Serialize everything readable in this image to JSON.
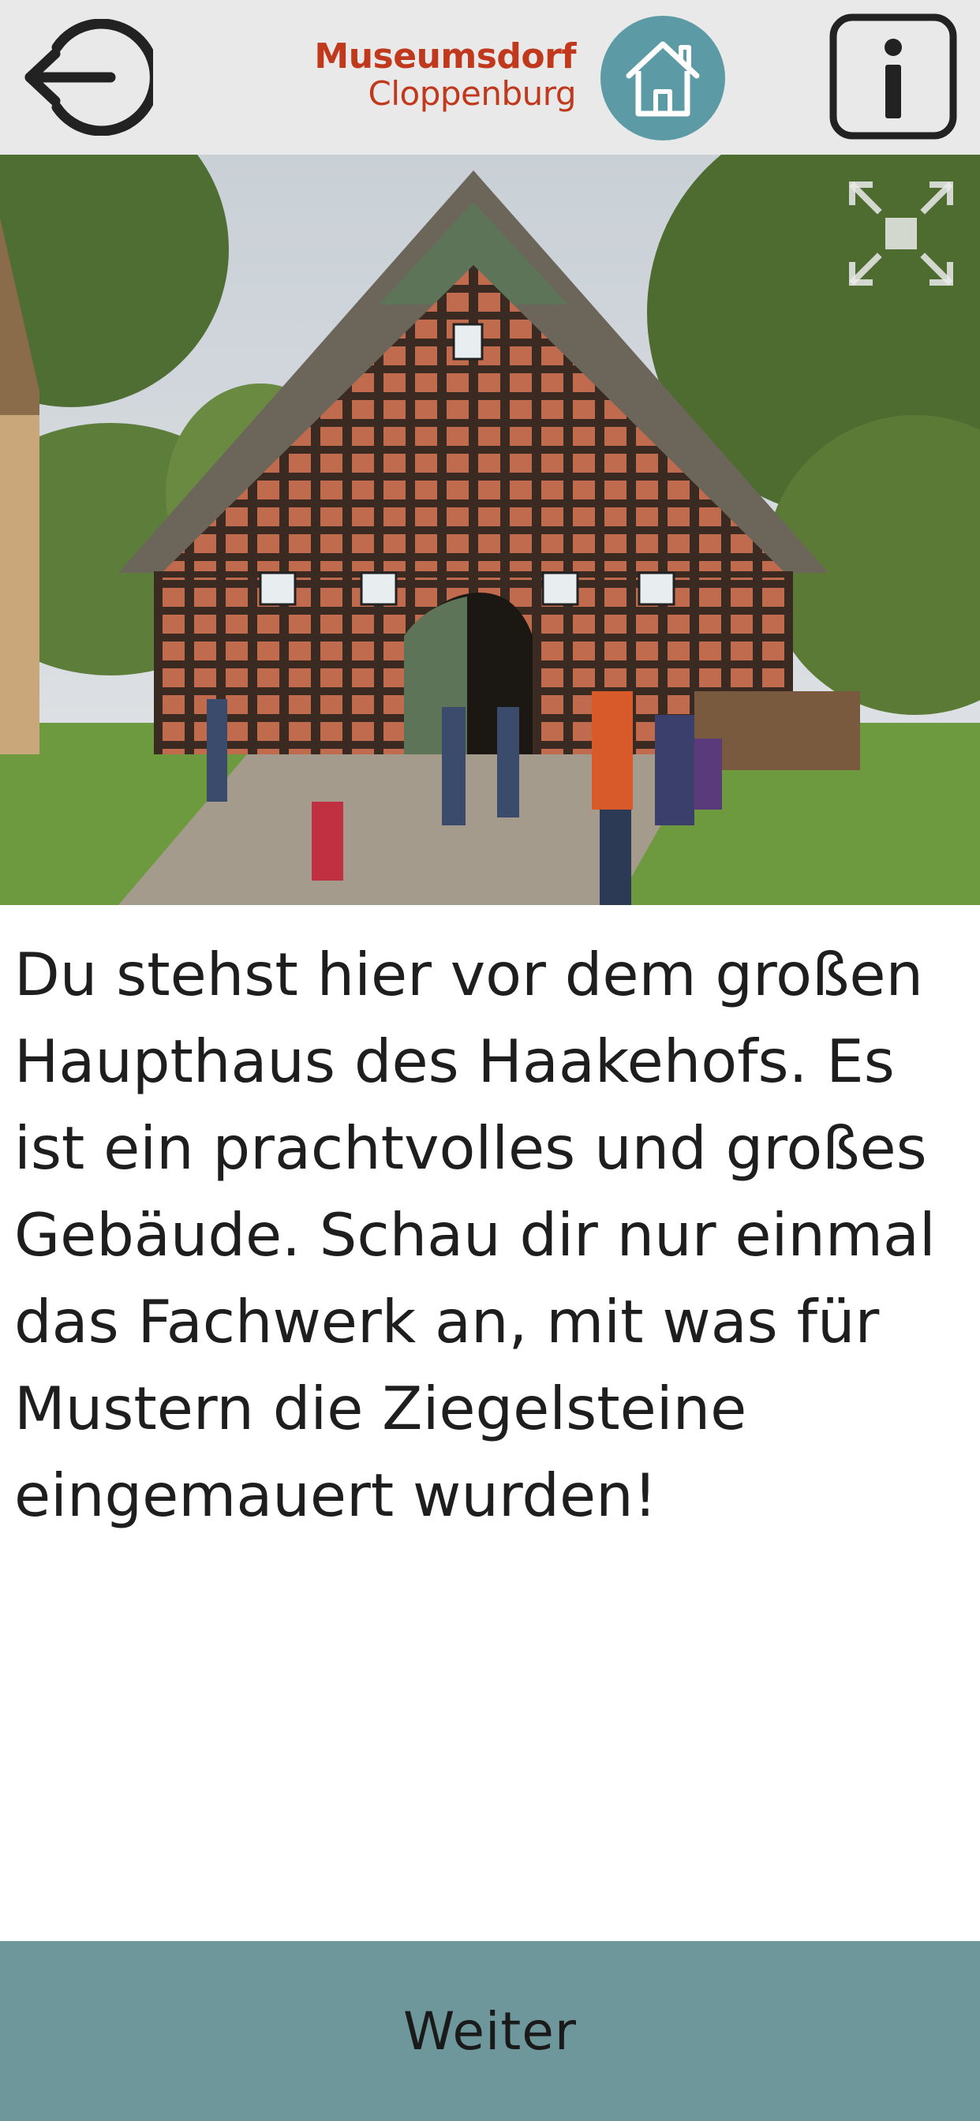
{
  "header": {
    "back_icon": "logout-arrow-icon",
    "logo_line1": "Museumsdorf",
    "logo_line2": "Cloppenburg",
    "home_icon": "home-icon",
    "info_icon": "info-icon",
    "brand_color": "#c0391c",
    "home_color": "#5c9aa5"
  },
  "photo": {
    "expand_icon": "fullscreen-expand-icon"
  },
  "content": {
    "description": "Du stehst hier vor dem großen Haupthaus des Haakehofs. Es ist ein prachtvolles und großes Gebäude. Schau dir nur einmal das Fachwerk an, mit was für Mustern die Ziegelsteine eingemauert wurden!"
  },
  "footer": {
    "next_label": "Weiter",
    "color": "#6e979c"
  }
}
